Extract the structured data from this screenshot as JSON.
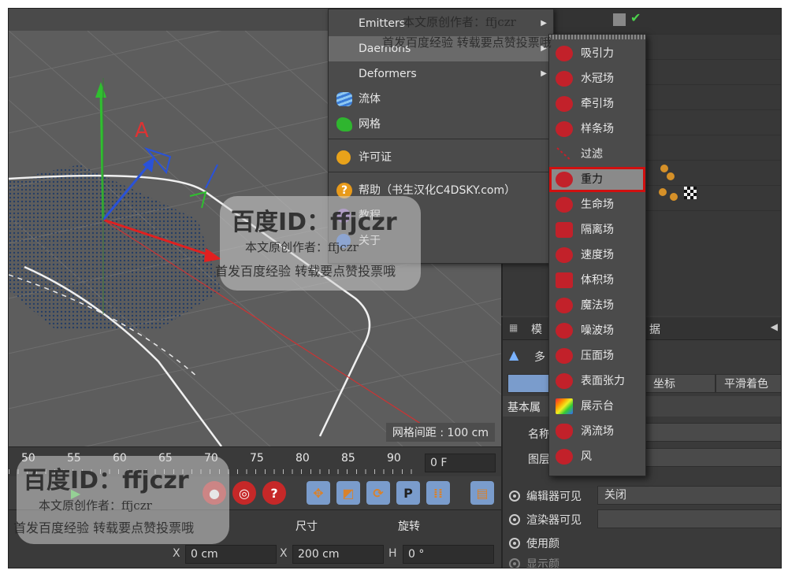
{
  "viewport": {
    "grid_spacing_label": "网格间距 : 100 cm"
  },
  "timeline": {
    "ticks": [
      "50",
      "55",
      "60",
      "65",
      "70",
      "75",
      "80",
      "85",
      "90"
    ],
    "current_frame": "0 F"
  },
  "coords": {
    "size_header": "尺寸",
    "rotation_header": "旋转",
    "x_label": "X",
    "x_value": "0 cm",
    "size_x_label": "X",
    "size_x_value": "200 cm",
    "h_label": "H",
    "h_value": "0 °"
  },
  "menu": {
    "items": [
      {
        "label": "Emitters",
        "has_submenu": true
      },
      {
        "label": "Daemons",
        "has_submenu": true,
        "highlighted": true
      },
      {
        "label": "Deformers",
        "has_submenu": true
      },
      {
        "label": "流体",
        "icon": "fluid-icon"
      },
      {
        "label": "网格",
        "icon": "mesh-icon"
      },
      {
        "label": "许可证",
        "icon": "license-icon"
      },
      {
        "label": "帮助（书生汉化C4DSKY.com）",
        "icon": "help-icon"
      },
      {
        "label": "教程",
        "icon": "tutorial-icon"
      },
      {
        "label": "关于",
        "icon": "about-icon"
      }
    ]
  },
  "daemons_submenu": {
    "items": [
      "吸引力",
      "水冠场",
      "牵引场",
      "样条场",
      "过滤",
      "重力",
      "生命场",
      "隔离场",
      "速度场",
      "体积场",
      "魔法场",
      "噪波场",
      "压面场",
      "表面张力",
      "展示台",
      "涡流场",
      "风"
    ],
    "selected": "重力"
  },
  "attributes": {
    "header_fragment": "据",
    "mode_fragment": "模",
    "object_fragment": "多",
    "tabs": [
      "",
      "坐标",
      "平滑着色(Pl"
    ],
    "section": "基本属",
    "fields": [
      {
        "label": "名称",
        "value": ""
      },
      {
        "label": "图层",
        "value": ""
      }
    ],
    "radios": [
      {
        "label": "编辑器可见",
        "value": "关闭"
      },
      {
        "label": "渲染器可见",
        "value": ""
      },
      {
        "label": "使用颜",
        "value": ""
      },
      {
        "label": "显示颜",
        "value": ""
      }
    ]
  },
  "watermarks": {
    "baidu_id": "百度ID：ffjczr",
    "author": "本文原创作者：ffjczr",
    "notice": "首发百度经验  转载要点赞投票哦"
  },
  "colors": {
    "accent_select": "#d01010",
    "daemon_icon": "#c2212a",
    "tab_active": "#7a9ccc"
  }
}
